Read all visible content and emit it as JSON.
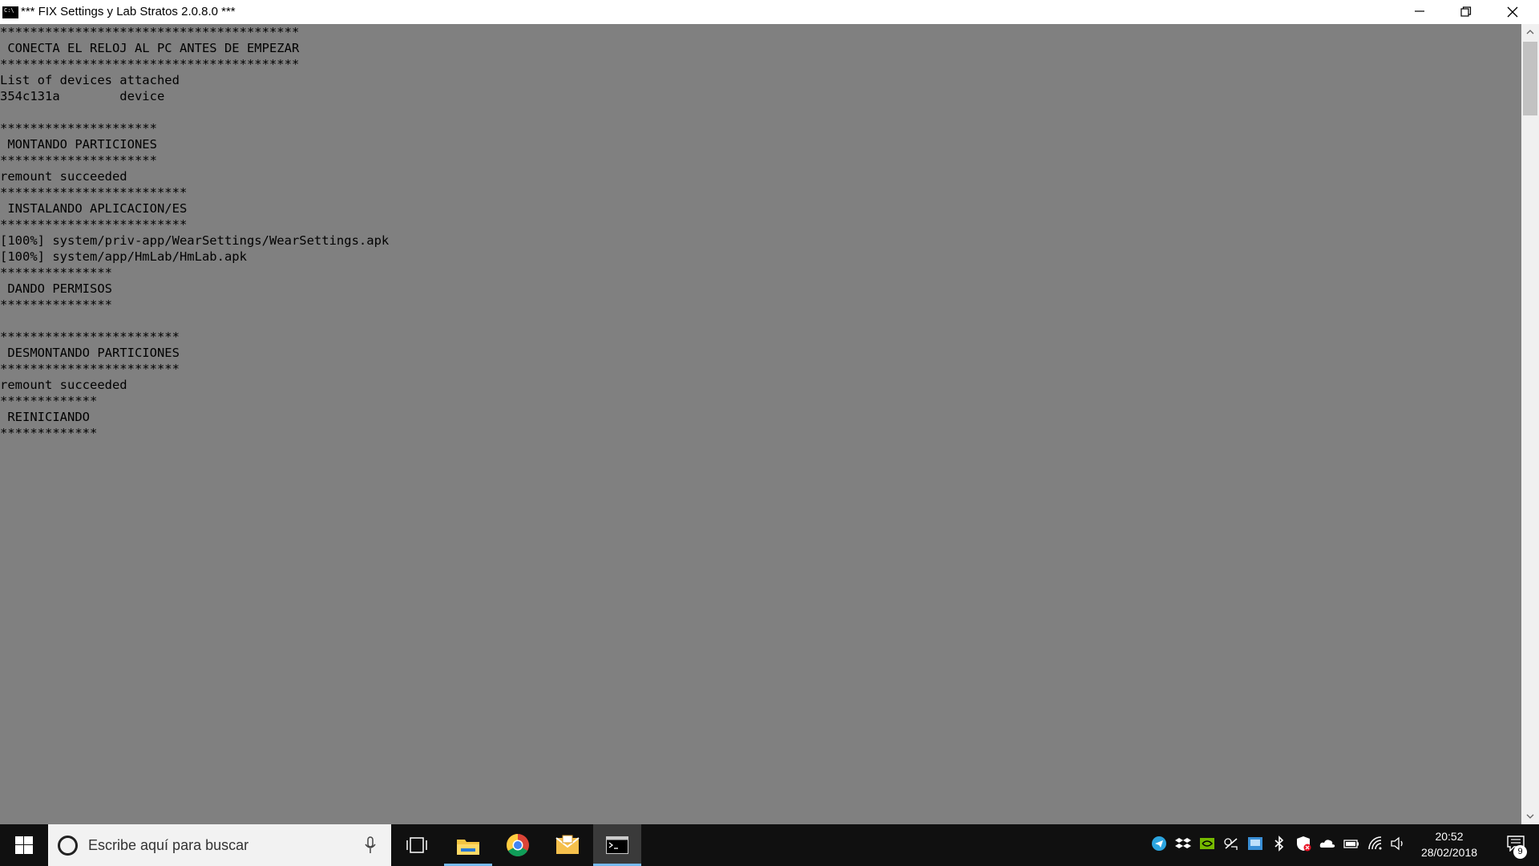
{
  "window": {
    "title": "*** FIX Settings y Lab Stratos 2.0.8.0 ***",
    "icon_label": "C:\\",
    "background_color": "#808080",
    "text_color": "#000000"
  },
  "console": {
    "lines": [
      "****************************************",
      " CONECTA EL RELOJ AL PC ANTES DE EMPEZAR",
      "****************************************",
      "List of devices attached",
      "354c131a        device",
      "",
      "*********************",
      " MONTANDO PARTICIONES",
      "*********************",
      "remount succeeded",
      "*************************",
      " INSTALANDO APLICACION/ES",
      "*************************",
      "[100%] system/priv-app/WearSettings/WearSettings.apk",
      "[100%] system/app/HmLab/HmLab.apk",
      "***************",
      " DANDO PERMISOS",
      "***************",
      "",
      "************************",
      " DESMONTANDO PARTICIONES",
      "************************",
      "remount succeeded",
      "*************",
      " REINICIANDO",
      "*************"
    ]
  },
  "taskbar": {
    "search_placeholder": "Escribe aquí para buscar",
    "apps": [
      {
        "name": "file-explorer-icon",
        "active": true,
        "selected": false
      },
      {
        "name": "chrome-icon",
        "active": false,
        "selected": false
      },
      {
        "name": "mail-icon",
        "active": false,
        "selected": false
      },
      {
        "name": "command-prompt-icon",
        "active": true,
        "selected": true
      }
    ],
    "tray_icons": [
      "telegram-icon",
      "dropbox-icon",
      "nvidia-icon",
      "cast-icon",
      "network-drive-icon",
      "bluetooth-icon",
      "security-shield-icon",
      "onedrive-icon",
      "battery-icon",
      "wifi-icon",
      "volume-icon"
    ],
    "time": "20:52",
    "date": "28/02/2018",
    "notification_count": "9",
    "accent_color": "#76b9ed"
  }
}
